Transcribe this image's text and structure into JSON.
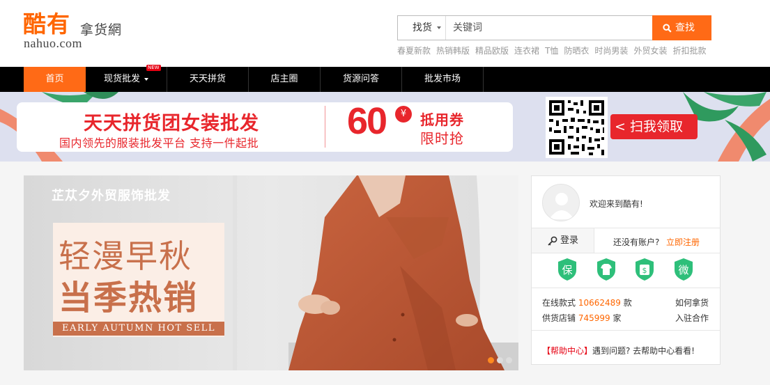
{
  "logo": {
    "main": "酷有",
    "sub": "拿货網",
    "domain": "nahuo.com"
  },
  "search": {
    "category": "找货",
    "placeholder": "关键词",
    "button": "查找",
    "hotwords": [
      "春夏新款",
      "热销韩版",
      "精品欧版",
      "连衣裙",
      "T恤",
      "防晒衣",
      "时尚男装",
      "外贸女装",
      "折扣批款"
    ]
  },
  "nav": {
    "items": [
      {
        "label": "首页"
      },
      {
        "label": "现货批发"
      },
      {
        "label": "天天拼货"
      },
      {
        "label": "店主圈"
      },
      {
        "label": "货源问答"
      },
      {
        "label": "批发市场"
      }
    ],
    "new_badge": "NEW"
  },
  "banner": {
    "title": "天天拼货团女装批发",
    "subtitle": "国内领先的服装批发平台  支持一件起批",
    "amount": "60",
    "currency": "¥",
    "coupon": "抵用券",
    "limited": "限时抢",
    "scan_button": "< 扫我领取"
  },
  "hero": {
    "brand": "芷苁夕外贸服饰批发",
    "line1": "轻漫早秋",
    "line2": "当季热销",
    "line3": "EARLY AUTUMN HOT SELL",
    "slides_count": 3,
    "active_slide": 1
  },
  "side": {
    "welcome": "欢迎来到酷有!",
    "login": "登录",
    "no_account": "还没有账户?",
    "register": "立即注册",
    "badges": [
      "保",
      "T恤",
      "$",
      "微"
    ],
    "online_label": "在线款式",
    "online_count": "10662489",
    "online_unit": "款",
    "shops_label": "供货店铺",
    "shops_count": "745999",
    "shops_unit": "家",
    "how_to": "如何拿货",
    "join": "入驻合作",
    "help_center": "【帮助中心】",
    "help_text": "遇到问题? 去帮助中心看看!"
  },
  "colors": {
    "accent": "#ff6a16",
    "red": "#e8262c",
    "badge_green": "#2ebf7a"
  }
}
